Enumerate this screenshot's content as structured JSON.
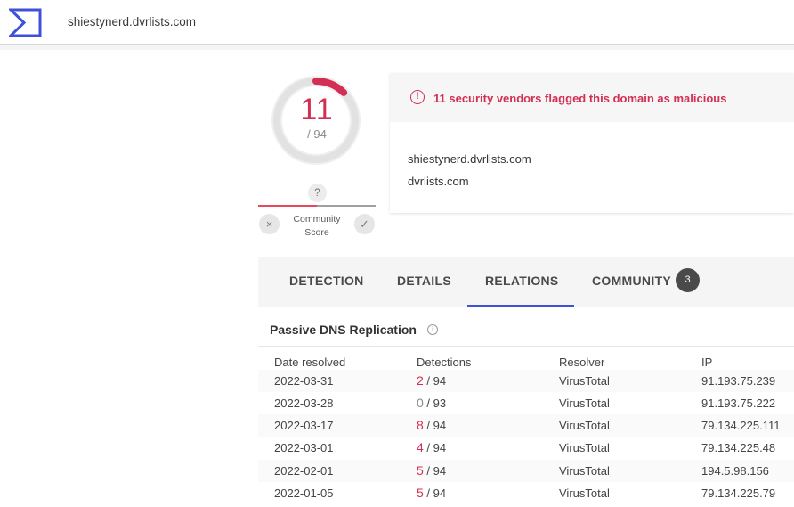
{
  "header": {
    "search_value": "shiestynerd.dvrlists.com",
    "logo_icon": "virustotal-logo-icon",
    "accent": "#3f51d8"
  },
  "score": {
    "malicious": "11",
    "total": "/ 94",
    "accent": "#d32f55",
    "community": {
      "question_mark": "?",
      "label_line1": "Community",
      "label_line2": "Score",
      "vote_down_icon": "×",
      "vote_up_icon": "✓"
    }
  },
  "alert": {
    "icon": "!",
    "text": "11 security vendors flagged this domain as malicious"
  },
  "domains": [
    "shiestynerd.dvrlists.com",
    "dvrlists.com"
  ],
  "tabs": [
    {
      "label": "DETECTION"
    },
    {
      "label": "DETAILS"
    },
    {
      "label": "RELATIONS",
      "active": true
    },
    {
      "label": "COMMUNITY",
      "badge": "3"
    }
  ],
  "passive_dns": {
    "title": "Passive DNS Replication",
    "info_icon": "i",
    "columns": [
      "Date resolved",
      "Detections",
      "Resolver",
      "IP"
    ],
    "rows": [
      {
        "date": "2022-03-31",
        "det": "2",
        "det_total": " / 94",
        "resolver": "VirusTotal",
        "ip": "91.193.75.239"
      },
      {
        "date": "2022-03-28",
        "det": "0",
        "det_total": " / 93",
        "resolver": "VirusTotal",
        "ip": "91.193.75.222"
      },
      {
        "date": "2022-03-17",
        "det": "8",
        "det_total": " / 94",
        "resolver": "VirusTotal",
        "ip": "79.134.225.111"
      },
      {
        "date": "2022-03-01",
        "det": "4",
        "det_total": " / 94",
        "resolver": "VirusTotal",
        "ip": "79.134.225.48"
      },
      {
        "date": "2022-02-01",
        "det": "5",
        "det_total": " / 94",
        "resolver": "VirusTotal",
        "ip": "194.5.98.156"
      },
      {
        "date": "2022-01-05",
        "det": "5",
        "det_total": " / 94",
        "resolver": "VirusTotal",
        "ip": "79.134.225.79"
      }
    ]
  }
}
